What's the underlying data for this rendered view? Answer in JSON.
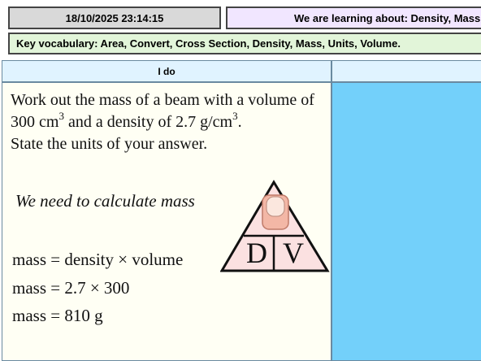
{
  "header": {
    "datetime": "18/10/2025 23:14:15",
    "objective": "We are learning about: Density, Mass, Volume",
    "vocab": "Key vocabulary: Area, Convert, Cross Section, Density, Mass, Units, Volume."
  },
  "ido": {
    "header": "I do",
    "question": {
      "part1": "Work out the mass of a beam with a volume of 300 cm",
      "exp1": "3",
      "part2": " and a density of 2.7 g/cm",
      "exp2": "3",
      "part3": ".",
      "line2": "State the units of your answer."
    },
    "hint": "We need to calculate mass",
    "equations": {
      "eq1": "mass = density × volume",
      "eq2": "mass = 2.7 × 300",
      "eq3": "mass = 810 g"
    },
    "triangle": {
      "d": "D",
      "v": "V",
      "fill": "#fbe1e1"
    }
  },
  "colors": {
    "date_bg": "#d9d9d9",
    "objective_bg": "#f1e6ff",
    "vocab_bg": "#e2f5d9",
    "panel_bg": "#fffff4",
    "blue_panel": "#73d0fa"
  }
}
